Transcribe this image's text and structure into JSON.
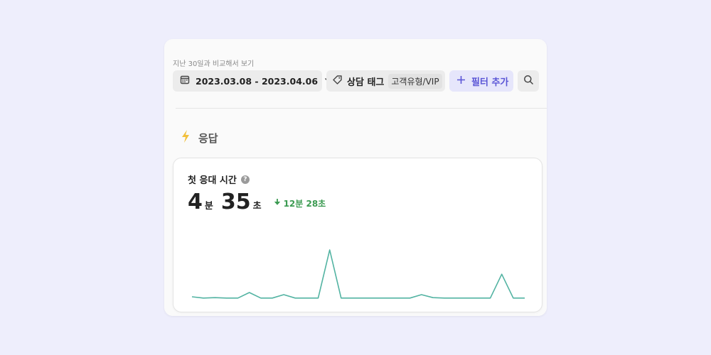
{
  "header": {
    "compare_label": "지난 30일과 비교해서 보기"
  },
  "filters": {
    "date_range": "2023.03.08 - 2023.04.06",
    "tag_label": "상담 태그",
    "tag_value": "고객유형/VIP",
    "add_filter_label": "필터 추가"
  },
  "section": {
    "title": "응답",
    "icon": "lightning-icon"
  },
  "metric": {
    "title": "첫 응대 시간",
    "minutes": "4",
    "minutes_unit": "분",
    "seconds": "35",
    "seconds_unit": "초",
    "delta": "12분 28초",
    "delta_color": "#3c9b52"
  },
  "colors": {
    "accent": "#5a55d6",
    "line": "#52b3a2",
    "bolt": "#f2c03c"
  },
  "chart_data": {
    "type": "line",
    "x_count": 30,
    "values": [
      0.5,
      0.2,
      0.3,
      0.2,
      0.2,
      1.5,
      0.2,
      0.2,
      1.0,
      0.2,
      0.2,
      0.2,
      11.5,
      0.2,
      0.2,
      0.2,
      0.2,
      0.2,
      0.2,
      0.2,
      1.0,
      0.3,
      0.2,
      0.2,
      0.2,
      0.2,
      0.2,
      5.8,
      0.2,
      0.2
    ],
    "ylim": [
      0,
      13
    ],
    "grid": false,
    "legend": "none"
  }
}
